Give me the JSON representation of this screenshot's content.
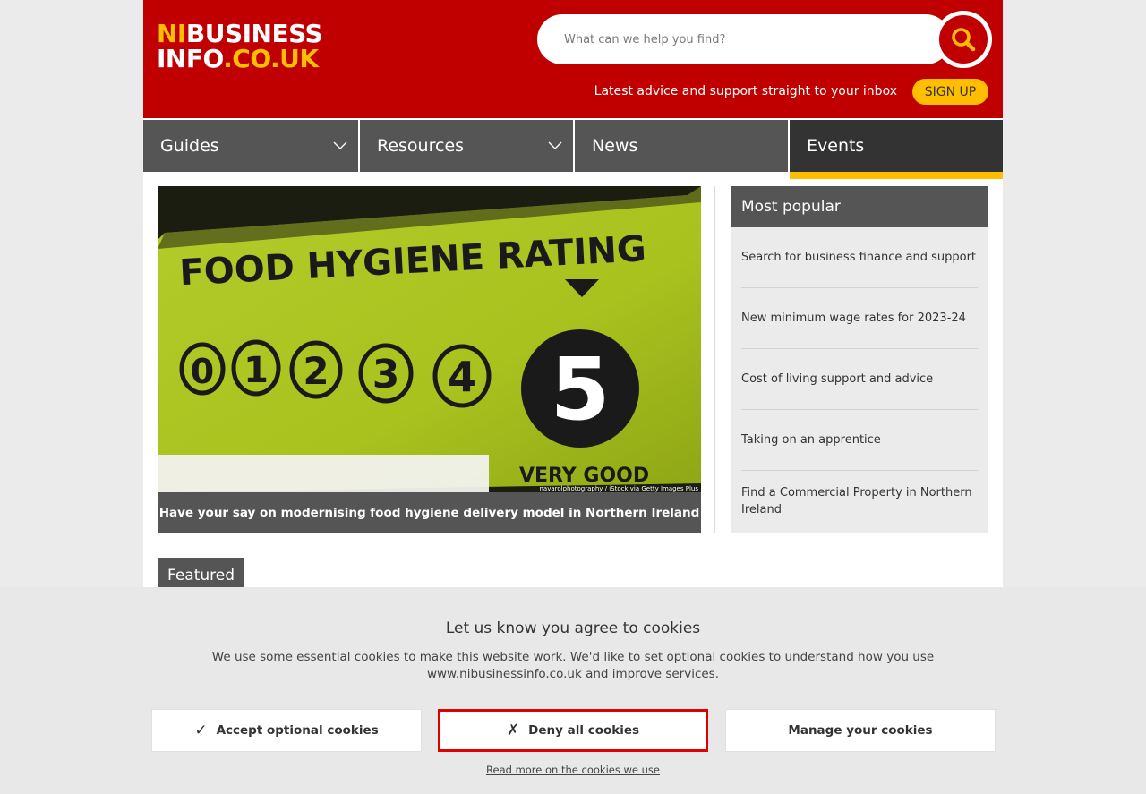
{
  "header": {
    "logo": {
      "line1_a": "NI",
      "line1_b": "BUSINESS",
      "line2_a": "INFO",
      "line2_b": ".CO.UK"
    },
    "search": {
      "placeholder": "What can we help you find?"
    },
    "signup_text": "Latest advice and support straight to your inbox",
    "signup_button": "SIGN UP"
  },
  "nav": {
    "items": [
      {
        "label": "Guides"
      },
      {
        "label": "Resources"
      },
      {
        "label": "News"
      },
      {
        "label": "Events"
      }
    ]
  },
  "hero": {
    "image_text": {
      "heading": "FOOD HYGIENE RATING",
      "ratings": [
        "0",
        "1",
        "2",
        "3",
        "4",
        "5"
      ],
      "very_good": "VERY GOOD",
      "credit": "navarolphotography / iStock via Getty Images Plus"
    },
    "caption": "Have your say on modernising food hygiene delivery model in Northern Ireland"
  },
  "popular": {
    "title": "Most popular",
    "items": [
      "Search for business finance and support",
      "New minimum wage rates for 2023-24",
      "Cost of living support and advice",
      "Taking on an apprentice",
      "Find a Commercial Property in Northern Ireland"
    ]
  },
  "featured": {
    "label": "Featured"
  },
  "cookie": {
    "title": "Let us know you agree to cookies",
    "text": "We use some essential cookies to make this website work. We'd like to set optional cookies to understand how you use www.nibusinessinfo.co.uk and improve services.",
    "accept_icon": "✓",
    "accept_label": "Accept optional cookies",
    "deny_icon": "✗",
    "deny_label": "Deny all cookies",
    "manage_label": "Manage your cookies",
    "read_more": "Read more on the cookies we use"
  },
  "colors": {
    "brand_red": "#c00000",
    "brand_yellow": "#ffbe00",
    "nav_grey": "#555555",
    "nav_active": "#333333",
    "hero_green": "#a9c21e"
  }
}
